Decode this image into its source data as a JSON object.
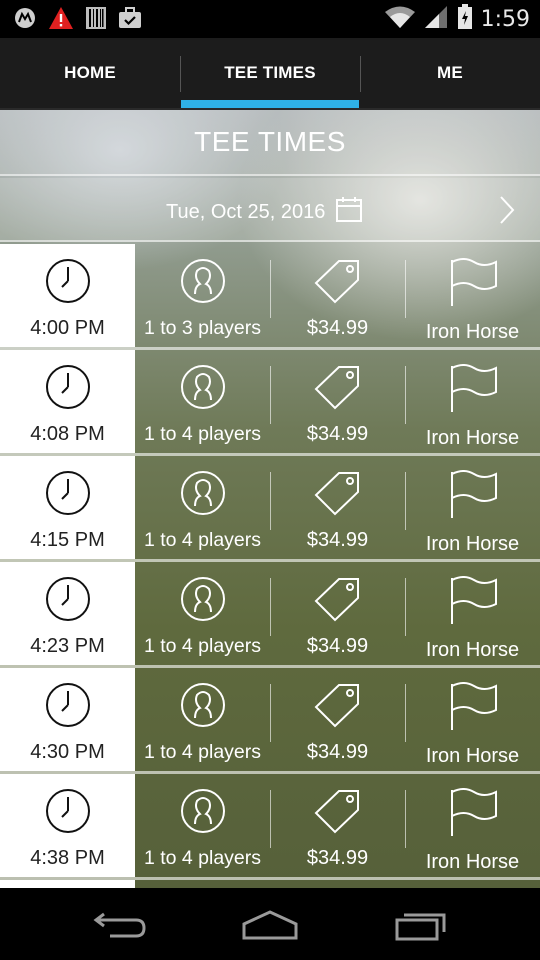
{
  "status_bar": {
    "time": "1:59",
    "icons": [
      "motorola-icon",
      "warning-icon",
      "barcode-icon",
      "briefcase-check-icon",
      "wifi-icon",
      "signal-icon",
      "battery-icon"
    ]
  },
  "tabs": [
    {
      "label": "HOME",
      "active": false
    },
    {
      "label": "TEE TIMES",
      "active": true
    },
    {
      "label": "ME",
      "active": false
    }
  ],
  "colors": {
    "accent": "#2fb1e6",
    "tab_bg": "#1c1c1c",
    "time_cell_bg": "#ffffff"
  },
  "header": {
    "title": "TEE TIMES",
    "date": "Tue, Oct 25, 2016"
  },
  "tee_times": [
    {
      "time": "4:00 PM",
      "players": "1 to 3 players",
      "price": "$34.99",
      "course": "Iron Horse"
    },
    {
      "time": "4:08 PM",
      "players": "1 to 4 players",
      "price": "$34.99",
      "course": "Iron Horse"
    },
    {
      "time": "4:15 PM",
      "players": "1 to 4 players",
      "price": "$34.99",
      "course": "Iron Horse"
    },
    {
      "time": "4:23 PM",
      "players": "1 to 4 players",
      "price": "$34.99",
      "course": "Iron Horse"
    },
    {
      "time": "4:30 PM",
      "players": "1 to 4 players",
      "price": "$34.99",
      "course": "Iron Horse"
    },
    {
      "time": "4:38 PM",
      "players": "1 to 4 players",
      "price": "$34.99",
      "course": "Iron Horse"
    }
  ],
  "nav_bar": {
    "icons": [
      "back-icon",
      "home-icon",
      "recent-apps-icon"
    ]
  }
}
